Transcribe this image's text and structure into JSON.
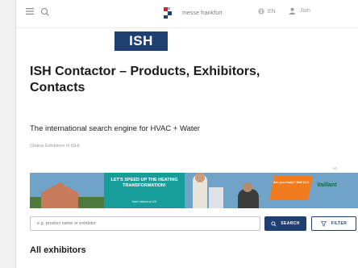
{
  "header": {
    "brand_name": "messe frankfurt",
    "language": "EN",
    "account_label": "Join"
  },
  "event_logo": "ISH",
  "page": {
    "title": "ISH Contactor – Products, Exhibitors, Contacts",
    "subtitle": "The international search engine for HVAC + Water",
    "status": "(Status Exhibitors of ISH)"
  },
  "ad": {
    "label": "Ad",
    "headline": "Let's speed up the heating transformation!",
    "subline": "Meet Vaillant at ISH",
    "secondary": "Are you ready? Hall 12.1",
    "advertiser": "Vaillant"
  },
  "search": {
    "placeholder": "e.g. product name or exhibitor",
    "search_label": "SEARCH",
    "filter_label": "FILTER"
  },
  "results": {
    "heading": "All exhibitors"
  },
  "colors": {
    "primary": "#1f3f73",
    "ad_teal": "#179e9a",
    "ad_orange": "#f07c1f"
  }
}
